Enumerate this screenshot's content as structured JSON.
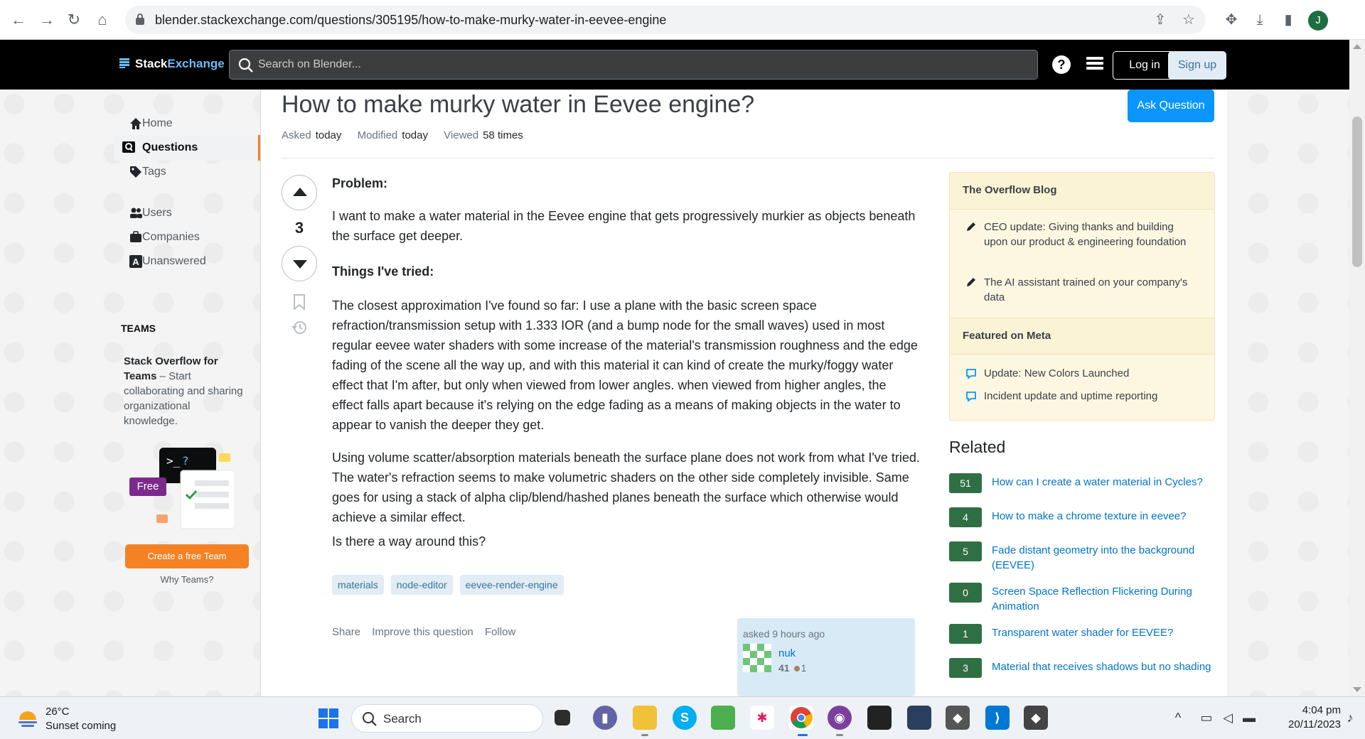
{
  "browser": {
    "url": "blender.stackexchange.com/questions/305195/how-to-make-murky-water-in-eevee-engine",
    "profile_initial": "J"
  },
  "topbar": {
    "logo_stack": "Stack",
    "logo_exchange": "Exchange",
    "search_placeholder": "Search on Blender...",
    "help_label": "?",
    "login_label": "Log in",
    "signup_label": "Sign up"
  },
  "sidebar": {
    "items": [
      {
        "label": "Home",
        "icon": "home-icon"
      },
      {
        "label": "Questions",
        "icon": "questions-icon"
      },
      {
        "label": "Tags",
        "icon": "tag-icon"
      },
      {
        "label": "Users",
        "icon": "users-icon"
      },
      {
        "label": "Companies",
        "icon": "briefcase-icon"
      },
      {
        "label": "Unanswered",
        "icon": "unanswered-icon"
      }
    ],
    "teams_heading": "TEAMS",
    "teams_title": "Stack Overflow for Teams",
    "teams_body": " – Start collaborating and sharing organizational knowledge.",
    "free_label": "Free",
    "create_team_label": "Create a free Team",
    "why_teams_label": "Why Teams?"
  },
  "question": {
    "title": "How to make murky water in Eevee engine?",
    "ask_label": "Ask Question",
    "asked_key": "Asked",
    "asked_val": "today",
    "modified_key": "Modified",
    "modified_val": "today",
    "viewed_key": "Viewed",
    "viewed_val": "58 times",
    "votes": "3",
    "heading_problem": "Problem:",
    "para_1": "I want to make a water material in the Eevee engine that gets progressively murkier as objects beneath the surface get deeper.",
    "heading_tried": "Things I've tried:",
    "para_2": "The closest approximation I've found so far: I use a plane with the basic screen space refraction/transmission setup with 1.333 IOR (and a bump node for the small waves) used in most regular eevee water shaders with some increase of the material's transmission roughness and the edge fading of the scene all the way up, and with this material it can kind of create the murky/foggy water effect that I'm after, but only when viewed from lower angles. when viewed from higher angles, the effect falls apart because it's relying on the edge fading as a means of making objects in the water to appear to vanish the deeper they get.",
    "para_3": "Using volume scatter/absorption materials beneath the surface plane does not work from what I've tried. The water's refraction seems to make volumetric shaders on the other side completely invisible. Same goes for using a stack of alpha clip/blend/hashed planes beneath the surface which otherwise would achieve a similar effect.",
    "para_4": "Is there a way around this?",
    "tags": [
      "materials",
      "node-editor",
      "eevee-render-engine"
    ],
    "share_label": "Share",
    "improve_label": "Improve this question",
    "follow_label": "Follow",
    "asked_ago": "asked 9 hours ago",
    "user_name": "nuk",
    "user_rep": "41",
    "user_bronze": "1"
  },
  "blog": {
    "heading": "The Overflow Blog",
    "items": [
      "CEO update: Giving thanks and building upon our product & engineering foundation",
      "The AI assistant trained on your company's data"
    ],
    "meta_heading": "Featured on Meta",
    "meta_items": [
      "Update: New Colors Launched",
      "Incident update and uptime reporting"
    ]
  },
  "related": {
    "heading": "Related",
    "items": [
      {
        "score": "51",
        "text": "How can I create a water material in Cycles?"
      },
      {
        "score": "4",
        "text": "How to make a chrome texture in eevee?"
      },
      {
        "score": "5",
        "text": "Fade distant geometry into the background (EEVEE)"
      },
      {
        "score": "0",
        "text": "Screen Space Reflection Flickering During Animation"
      },
      {
        "score": "1",
        "text": "Transparent water shader for EEVEE?"
      },
      {
        "score": "3",
        "text": "Material that receives shadows but no shading"
      }
    ]
  },
  "taskbar": {
    "temp": "26°C",
    "weather": "Sunset coming",
    "search_label": "Search",
    "time": "4:04 pm",
    "date": "20/11/2023"
  },
  "colors": {
    "accent_blue": "#0a95ff",
    "orange": "#f48225",
    "related_green": "#2f6f44"
  }
}
